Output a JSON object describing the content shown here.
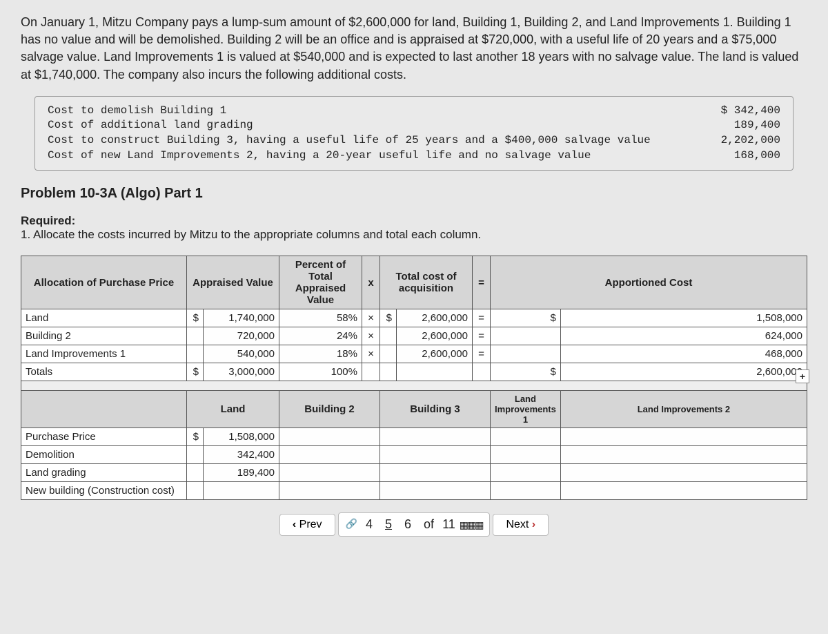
{
  "problem_text": "On January 1, Mitzu Company pays a lump-sum amount of $2,600,000 for land, Building 1, Building 2, and Land Improvements 1. Building 1 has no value and will be demolished. Building 2 will be an office and is appraised at $720,000, with a useful life of 20 years and a $75,000 salvage value. Land Improvements 1 is valued at $540,000 and is expected to last another 18 years with no salvage value. The land is valued at $1,740,000. The company also incurs the following additional costs.",
  "costs": {
    "labels": "Cost to demolish Building 1\nCost of additional land grading\nCost to construct Building 3, having a useful life of 25 years and a $400,000 salvage value\nCost of new Land Improvements 2, having a 20-year useful life and no salvage value",
    "values": "$ 342,400\n189,400\n2,202,000\n168,000"
  },
  "part_title": "Problem 10-3A (Algo) Part 1",
  "required": {
    "label": "Required:",
    "text": "1. Allocate the costs incurred by Mitzu to the appropriate columns and total each column."
  },
  "table1": {
    "h0": "Allocation of Purchase Price",
    "h1": "Appraised Value",
    "h2": "Percent of Total Appraised Value",
    "hx": "x",
    "h3": "Total cost of acquisition",
    "heq": "=",
    "h4": "Apportioned Cost",
    "rows": [
      {
        "label": "Land",
        "cur": "$",
        "appraised": "1,740,000",
        "pct": "58%",
        "x": "×",
        "acq_cur": "$",
        "acq": "2,600,000",
        "eq": "=",
        "cost_cur": "$",
        "cost": "1,508,000"
      },
      {
        "label": "Building 2",
        "cur": "",
        "appraised": "720,000",
        "pct": "24%",
        "x": "×",
        "acq_cur": "",
        "acq": "2,600,000",
        "eq": "=",
        "cost_cur": "",
        "cost": "624,000"
      },
      {
        "label": "Land Improvements 1",
        "cur": "",
        "appraised": "540,000",
        "pct": "18%",
        "x": "×",
        "acq_cur": "",
        "acq": "2,600,000",
        "eq": "=",
        "cost_cur": "",
        "cost": "468,000"
      },
      {
        "label": "Totals",
        "cur": "$",
        "appraised": "3,000,000",
        "pct": "100%",
        "x": "",
        "acq_cur": "",
        "acq": "",
        "eq": "",
        "cost_cur": "$",
        "cost": "2,600,000"
      }
    ]
  },
  "table2": {
    "h0": "",
    "h1": "Land",
    "h2": "Building 2",
    "h3": "Building 3",
    "h4": "Land Improvements 1",
    "h5": "Land Improvements 2",
    "rows": [
      {
        "label": "Purchase Price",
        "land_cur": "$",
        "land": "1,508,000",
        "b2": "",
        "b3": "",
        "li1": "",
        "li2": ""
      },
      {
        "label": "Demolition",
        "land_cur": "",
        "land": "342,400",
        "b2": "",
        "b3": "",
        "li1": "",
        "li2": ""
      },
      {
        "label": "Land grading",
        "land_cur": "",
        "land": "189,400",
        "b2": "",
        "b3": "",
        "li1": "",
        "li2": ""
      },
      {
        "label": "New building (Construction cost)",
        "land_cur": "",
        "land": "",
        "b2": "",
        "b3": "",
        "li1": "",
        "li2": ""
      }
    ]
  },
  "nav": {
    "prev": "Prev",
    "pages": [
      "4",
      "5",
      "6"
    ],
    "current": "5",
    "of": "of",
    "total": "11",
    "next": "Next"
  },
  "plus": "+"
}
